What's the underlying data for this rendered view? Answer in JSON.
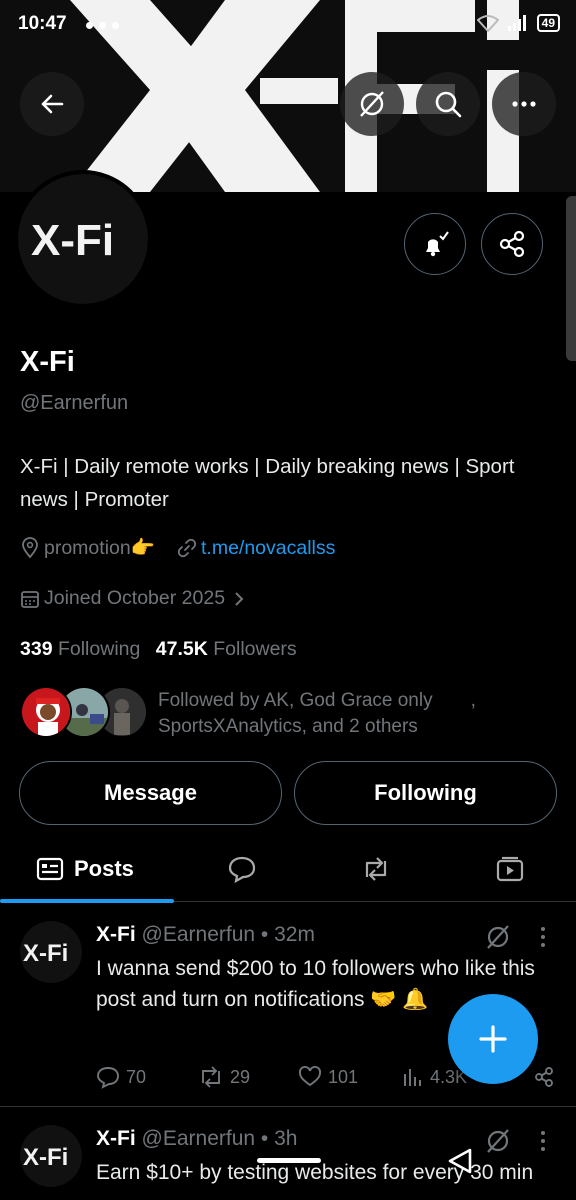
{
  "status_bar": {
    "time": "10:47",
    "battery": "49"
  },
  "banner": {
    "brand": "X-Fi"
  },
  "profile": {
    "name": "X-Fi",
    "handle": "@Earnerfun",
    "avatar_text": "X-Fi",
    "bio": "X-Fi | Daily remote works | Daily breaking news | Sport news | Promoter",
    "location": "promotion👉",
    "website": "t.me/novacallss",
    "joined": "Joined October 2025",
    "following_count": "339",
    "following_label": "Following",
    "followers_count": "47.5K",
    "followers_label": "Followers",
    "followed_by_line1": "Followed by AK, God Grace only",
    "followed_by_sep": ",",
    "followed_by_line2": "SportsXAnalytics, and 2 others"
  },
  "buttons": {
    "message": "Message",
    "following": "Following"
  },
  "tabs": {
    "posts": "Posts"
  },
  "posts": [
    {
      "name": "X-Fi",
      "handle": "@Earnerfun",
      "time": "• 32m",
      "text": "I wanna send $200 to 10 followers who like this post and turn on notifications 🤝 🔔",
      "replies": "70",
      "reposts": "29",
      "likes": "101",
      "views": "4.3K"
    },
    {
      "name": "X-Fi",
      "handle": "@Earnerfun",
      "time": "• 3h",
      "text": "Earn $10+ by testing websites for every 30 min"
    }
  ],
  "colors": {
    "accent": "#1d9bf0",
    "muted": "#71767b",
    "border": "#2f3336"
  }
}
